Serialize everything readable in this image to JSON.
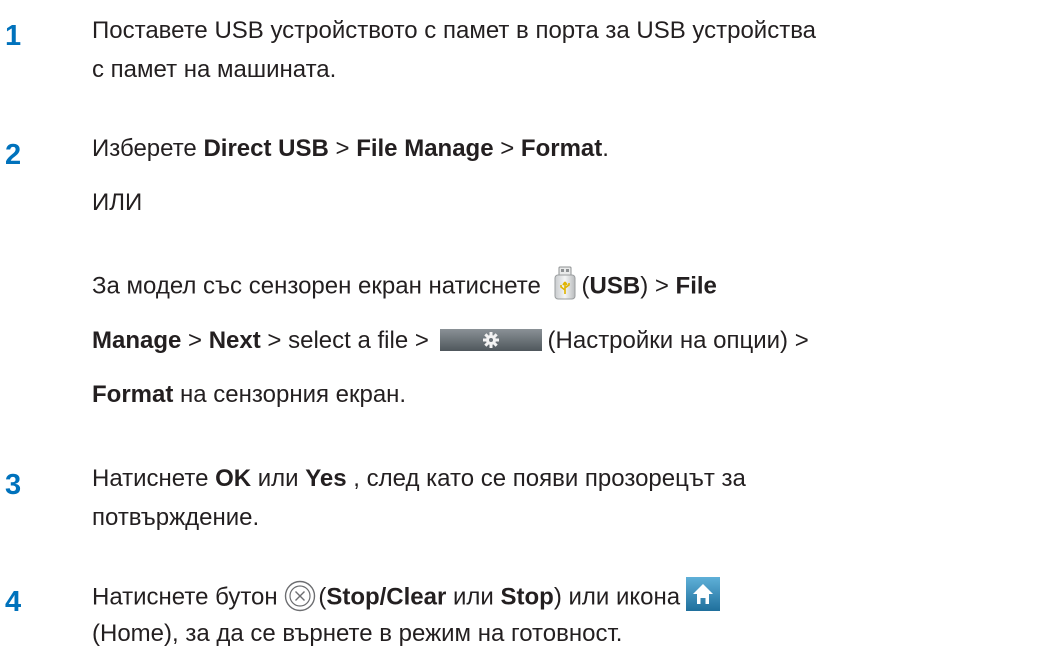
{
  "steps": [
    {
      "number": "1",
      "line1": "Поставете USB устройството с памет в порта за USB устройства",
      "line2": "с памет на машината."
    },
    {
      "number": "2",
      "prefix": "Изберете ",
      "path": [
        "Direct USB",
        "File Manage",
        "Format"
      ],
      "sep": " > ",
      "end": ".",
      "or_label": "ИЛИ",
      "touch": {
        "prefix": "За модел със сензорен екран натиснете",
        "usb_open": "(",
        "usb_label": "USB",
        "usb_close": ") > ",
        "file": "File",
        "manage": "Manage",
        "next": "Next",
        "select": " > select a file > ",
        "options": "(Настройки на опции) >",
        "format": "Format",
        "suffix": " на сензорния екран."
      }
    },
    {
      "number": "3",
      "prefix": "Натиснете ",
      "ok": "OK",
      "or": " или ",
      "yes": "Yes",
      "rest": " , след като се появи прозорецът за",
      "line2": "потвърждение."
    },
    {
      "number": "4",
      "prefix": "Натиснете бутон ",
      "stop_clear": "Stop/Clear",
      "or": " или ",
      "stop": "Stop",
      "mid": ") или икона",
      "line2": "(Home), за да се върнете в режим на готовност."
    }
  ],
  "colors": {
    "step_number": "#0072bc",
    "text": "#231f20"
  },
  "icons": [
    "usb-icon",
    "gear-settings-icon",
    "stop-clear-icon",
    "home-icon"
  ]
}
